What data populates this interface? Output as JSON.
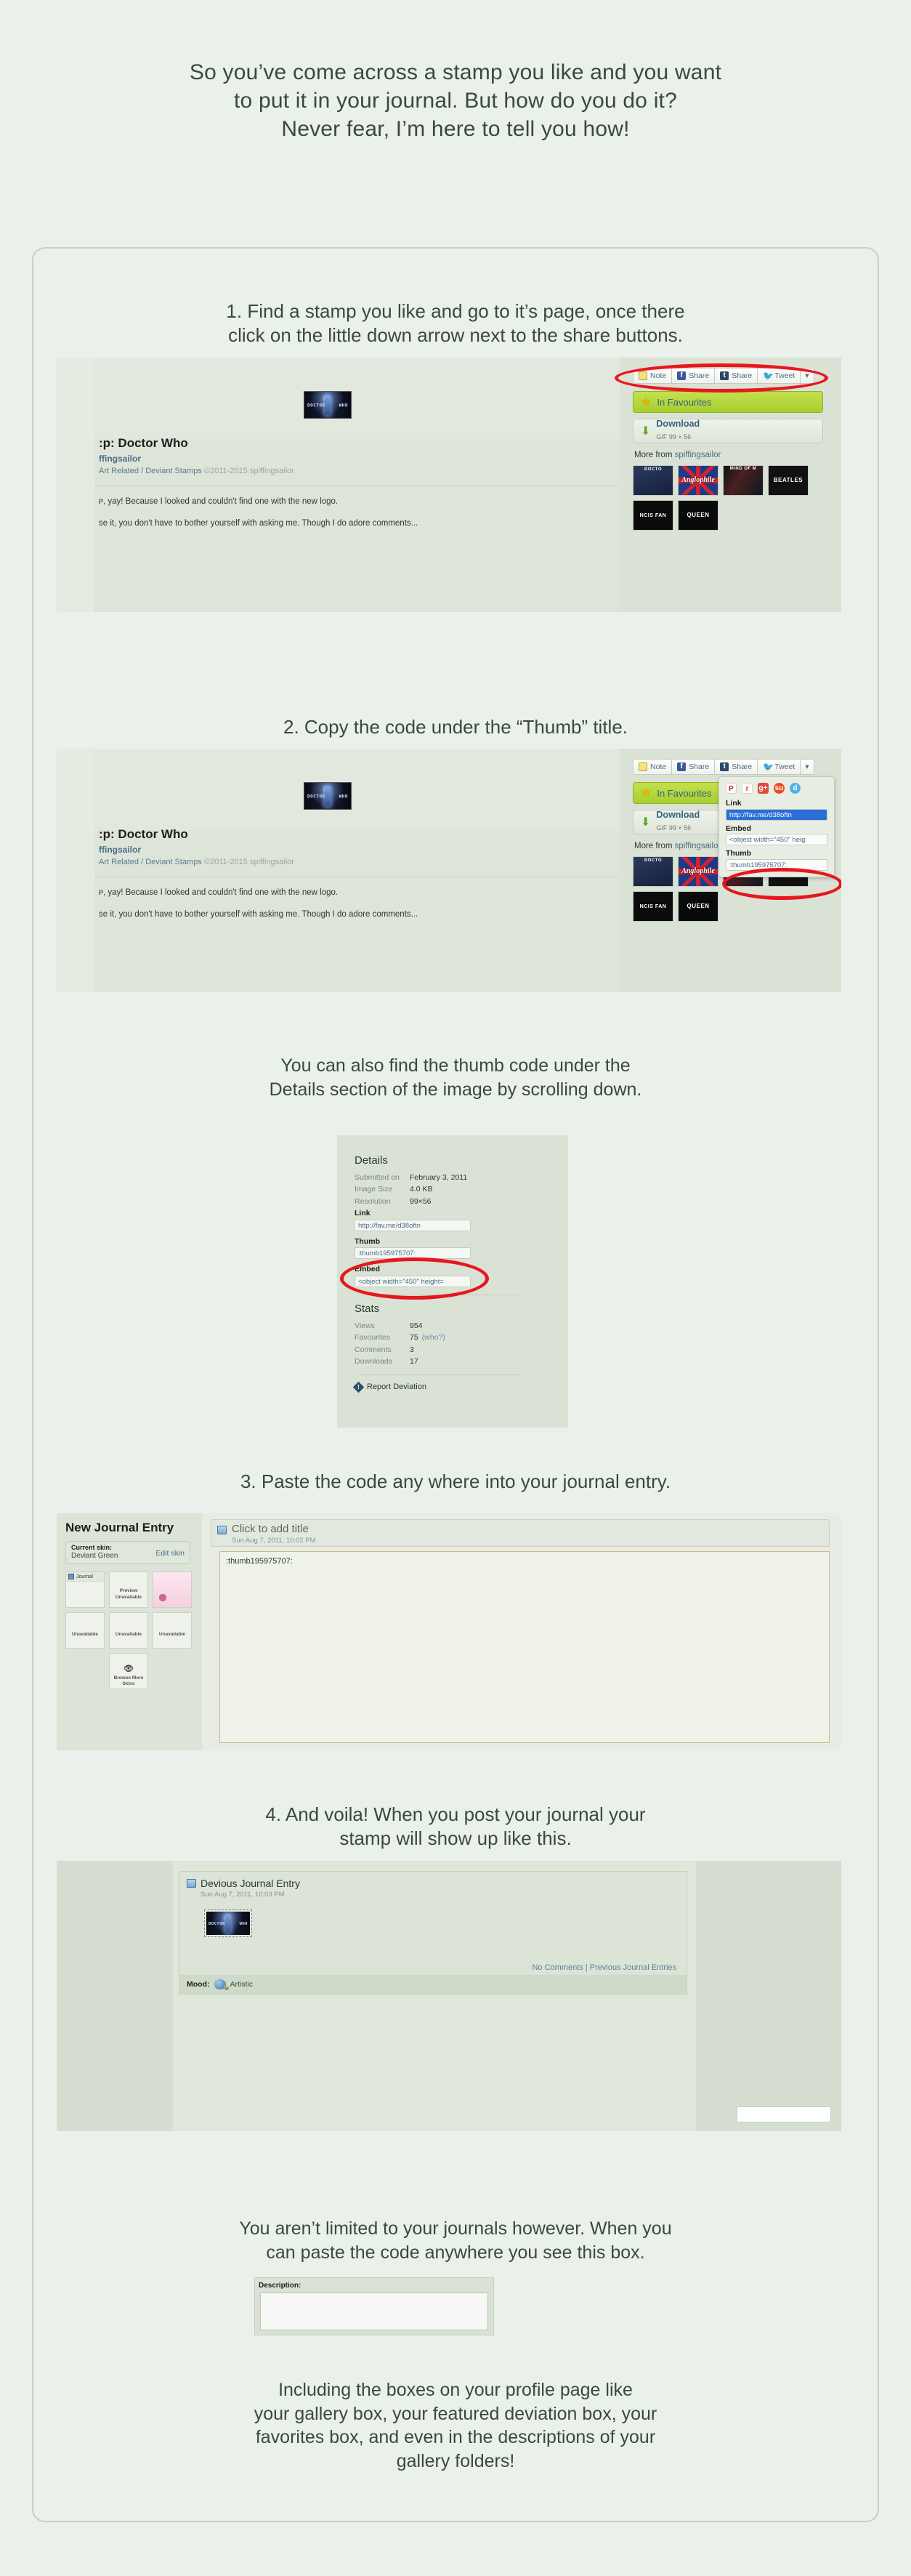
{
  "intro": {
    "line1": "So you’ve come across a stamp you like and you want",
    "line2": "to put it in your journal. But how do you do it?",
    "line3": "Never fear, I’m here to tell you how!"
  },
  "step1": {
    "heading_line1": "1. Find a stamp you like and go to it’s page, once there",
    "heading_line2": "click on the little down arrow next to the share buttons.",
    "deviation": {
      "title": ":p: Doctor Who",
      "author": "ffingsailor",
      "category": "Art Related / Deviant Stamps",
      "copyright": "©2011-2015 spiffingsailor",
      "description_line1": "ᴘ, yay! Because I looked and couldn't find one with the new logo.",
      "description_line2": "ѕe it, you don't have to bother yourself with asking me. Though I do adore comments...",
      "stamp_label_left": "DOCTOR",
      "stamp_label_right": "WHO"
    },
    "share_buttons": [
      {
        "icon": "note-icon",
        "label": "Note"
      },
      {
        "icon": "facebook-icon",
        "label": "Share"
      },
      {
        "icon": "tumblr-icon",
        "label": "Share"
      },
      {
        "icon": "twitter-icon",
        "label": "Tweet"
      }
    ],
    "share_caret": "▾",
    "favourites_button": "In Favourites",
    "download_button": "Download",
    "download_meta": "GIF 99 × 56",
    "more_from": "More from ",
    "more_from_user": "spiffingsailor",
    "thumbs": [
      {
        "name": "doctor-who-thumb",
        "label": "DOCTO"
      },
      {
        "name": "anglophile-thumb",
        "label": "Anglophile"
      },
      {
        "name": "mind-of-man-thumb",
        "label": "MIND OF M"
      },
      {
        "name": "beatles-thumb",
        "label": "BEATLES"
      },
      {
        "name": "ncis-thumb",
        "label": "NCIS FAN"
      },
      {
        "name": "queen-thumb",
        "label": "QUEEN"
      }
    ]
  },
  "step2": {
    "heading": "2. Copy the code under the “Thumb” title.",
    "dropdown": {
      "social_icons": [
        "pinterest-icon",
        "reddit-icon",
        "google-plus-icon",
        "stumbleupon-icon",
        "deviantart-icon"
      ],
      "link_label": "Link",
      "link_value": "http://fav.me/d38oftn",
      "embed_label": "Embed",
      "embed_value": "<object width=\"450\" heig",
      "thumb_label": "Thumb",
      "thumb_value": ":thumb195975707:"
    }
  },
  "step2b": {
    "text_line1": "You can also find the thumb code under the",
    "text_line2": "Details section of the image by scrolling down.",
    "details": {
      "heading": "Details",
      "rows": [
        {
          "key": "Submitted on",
          "value": "February 3, 2011"
        },
        {
          "key": "Image Size",
          "value": "4.0 KB"
        },
        {
          "key": "Resolution",
          "value": "99×56"
        }
      ],
      "link_label": "Link",
      "link_value": "http://fav.me/d38oftn",
      "thumb_label": "Thumb",
      "thumb_value": ":thumb195975707:",
      "embed_label": "Embed",
      "embed_value": "<object width=\"450\" height=",
      "stats_heading": "Stats",
      "stats": [
        {
          "key": "Views",
          "value": "954"
        },
        {
          "key": "Favourites",
          "value": "75",
          "link": "(who?)"
        },
        {
          "key": "Comments",
          "value": "3"
        },
        {
          "key": "Downloads",
          "value": "17"
        }
      ],
      "report": "Report Deviation"
    }
  },
  "step3": {
    "heading": "3. Paste the code any where into your journal entry.",
    "editor": {
      "title": "New Journal Entry",
      "current_skin_label": "Current skin:",
      "current_skin_value": "Deviant Green",
      "edit_skin": "Edit skin",
      "skin_cards": [
        {
          "name": "journal-skin-card",
          "tab": "Journal",
          "mid": ""
        },
        {
          "name": "preview-unavailable-card",
          "tab": "",
          "mid": "Preview Unavailable"
        },
        {
          "name": "pink-skin-card",
          "tab": "",
          "mid": ""
        },
        {
          "name": "unavailable-card-1",
          "tab": "",
          "mid": "Unavailable"
        },
        {
          "name": "unavailable-card-2",
          "tab": "",
          "mid": "Unavailable"
        },
        {
          "name": "unavailable-card-3",
          "tab": "",
          "mid": "Unavailable"
        },
        {
          "name": "browse-more-skins-card",
          "tab": "",
          "mid": "Browse More Skins"
        }
      ],
      "title_placeholder": "Click to add title",
      "date": "Sun Aug 7, 2011, 10:02 PM",
      "body_code": ":thumb195975707:"
    }
  },
  "step4": {
    "heading_line1": "4. And voila! When you post your journal your",
    "heading_line2": "stamp will show up like this.",
    "journal": {
      "title": "Devious Journal Entry",
      "date": "Sun Aug 7, 2011, 10:03 PM",
      "comments_link": "No Comments",
      "separator": "|",
      "previous_link": "Previous Journal Entries",
      "mood_label": "Mood:",
      "mood_value": "Artistic"
    }
  },
  "outro": {
    "line1": "You aren’t limited to your journals however. When you",
    "line2": "can paste the code anywhere you see this box.",
    "description_label": "Description:",
    "closing_line1": "Including the boxes on your profile page like",
    "closing_line2": "your gallery box, your featured deviation box, your",
    "closing_line3": "favorites box, and even in the descriptions of your",
    "closing_line4": "gallery folders!"
  },
  "colors": {
    "background": "#eaf0ea",
    "text": "#3a4a3a",
    "highlight": "#e8161d",
    "panel": "#d9e2d4",
    "favourite_green": "#b4d93e",
    "link_blue": "#4a6d88"
  }
}
